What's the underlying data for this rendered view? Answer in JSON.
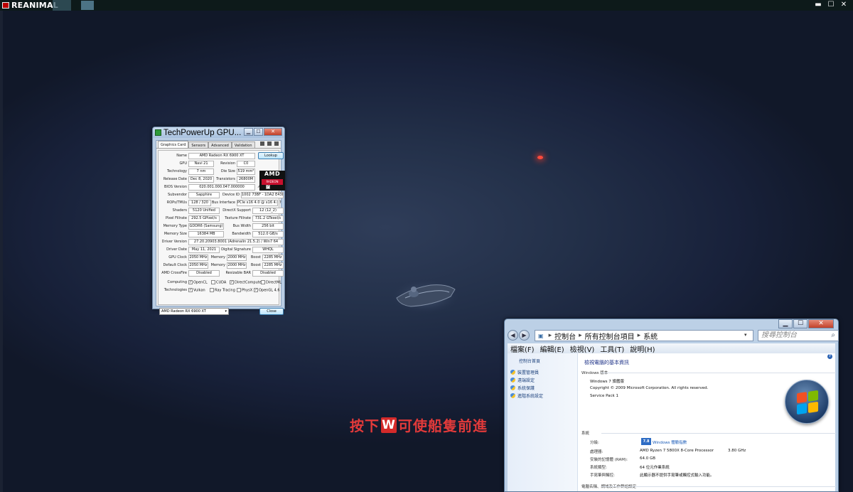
{
  "game": {
    "title": "REANIMAL",
    "hint_before": "按下",
    "hint_key": "W",
    "hint_after": "可使船隻前進"
  },
  "gpuz": {
    "title": "TechPowerUp GPU...",
    "tabs": [
      "Graphics Card",
      "Sensors",
      "Advanced",
      "Validation"
    ],
    "lookup_label": "Lookup",
    "uefi_label": "UEFI",
    "fields": {
      "name_label": "Name",
      "name": "AMD Radeon RX 6900 XT",
      "gpu_label": "GPU",
      "gpu": "Navi 21",
      "revision_label": "Revision",
      "revision": "C0",
      "technology_label": "Technology",
      "technology": "7 nm",
      "die_size_label": "Die Size",
      "die_size": "519 mm²",
      "release_date_label": "Release Date",
      "release_date": "Dec 8, 2020",
      "transistors_label": "Transistors",
      "transistors": "26800M",
      "bios_label": "BIOS Version",
      "bios": "020.001.000.047.000000",
      "subvendor_label": "Subvendor",
      "subvendor": "Sapphire",
      "device_id_label": "Device ID",
      "device_id": "1002 73BF - 1DA2 E438",
      "rops_label": "ROPs/TMUs",
      "rops": "128 / 320",
      "bus_interface_label": "Bus Interface",
      "bus_interface": "PCIe x16 4.0 @ x16 4.0",
      "shaders_label": "Shaders",
      "shaders": "5120 Unified",
      "directx_label": "DirectX Support",
      "directx": "12 (12_2)",
      "pixel_fillrate_label": "Pixel Fillrate",
      "pixel_fillrate": "292.5 GPixel/s",
      "texture_fillrate_label": "Texture Fillrate",
      "texture_fillrate": "731.2 GTexel/s",
      "memory_type_label": "Memory Type",
      "memory_type": "GDDR6 (Samsung)",
      "bus_width_label": "Bus Width",
      "bus_width": "256 bit",
      "memory_size_label": "Memory Size",
      "memory_size": "16384 MB",
      "bandwidth_label": "Bandwidth",
      "bandwidth": "512.0 GB/s",
      "driver_version_label": "Driver Version",
      "driver_version": "27.20.20903.8001 (Adrenalin 21.5.2) / Win7 64",
      "driver_date_label": "Driver Date",
      "driver_date": "May 11, 2021",
      "digital_signature_label": "Digital Signature",
      "digital_signature": "WHQL",
      "gpu_clock_label": "GPU Clock",
      "gpu_clock": "2050 MHz",
      "memory_label": "Memory",
      "memory_clock": "2000 MHz",
      "boost_label": "Boost",
      "boost_clock": "2285 MHz",
      "default_clock_label": "Default Clock",
      "default_clock": "2050 MHz",
      "default_memory_clock": "2000 MHz",
      "default_boost_clock": "2285 MHz",
      "crossfire_label": "AMD CrossFire",
      "crossfire": "Disabled",
      "resizable_bar_label": "Resizable BAR",
      "resizable_bar": "Disabled",
      "computing_label": "Computing",
      "technologies_label": "Technologies"
    },
    "computing": [
      {
        "label": "OpenCL",
        "checked": true
      },
      {
        "label": "CUDA",
        "checked": false
      },
      {
        "label": "DirectCompute",
        "checked": true
      },
      {
        "label": "DirectML",
        "checked": false
      }
    ],
    "technologies": [
      {
        "label": "Vulkan",
        "checked": true
      },
      {
        "label": "Ray Tracing",
        "checked": false
      },
      {
        "label": "PhysX",
        "checked": false
      },
      {
        "label": "OpenGL 4.6",
        "checked": true
      }
    ],
    "card_select": "AMD Radeon RX 6900 XT",
    "close_label": "Close",
    "logo_text": "AMD",
    "logo_sub": "RADEON"
  },
  "control_panel": {
    "breadcrumb": [
      "控制台",
      "所有控制台項目",
      "系統"
    ],
    "search_placeholder": "搜尋控制台",
    "menu": [
      "檔案(F)",
      "編輯(E)",
      "檢視(V)",
      "工具(T)",
      "說明(H)"
    ],
    "sidebar_home": "控制台首頁",
    "sidebar_items": [
      "裝置管理員",
      "遠端設定",
      "系統保護",
      "進階系統設定"
    ],
    "heading": "檢視電腦的基本資訊",
    "edition_section": "Windows 版本",
    "edition": "Windows 7 旗艦版",
    "copyright": "Copyright © 2009 Microsoft Corporation. All rights reserved.",
    "service_pack": "Service Pack 1",
    "system_section": "系統",
    "rating_label": "分級:",
    "rating_badge": "7.8",
    "rating_link": "Windows 體驗指數",
    "processor_label": "處理器:",
    "processor": "AMD Ryzen 7 5800X 8-Core Processor",
    "processor_speed": "3.80 GHz",
    "ram_label": "安裝的記憶體 (RAM):",
    "ram": "64.0 GB",
    "system_type_label": "系統類型:",
    "system_type": "64 位元作業系統",
    "pen_touch_label": "手寫筆與觸控:",
    "pen_touch": "此顯示器不提供手寫筆或觸控式輸入功能。",
    "name_section": "電腦名稱、網域及工作群組設定"
  }
}
